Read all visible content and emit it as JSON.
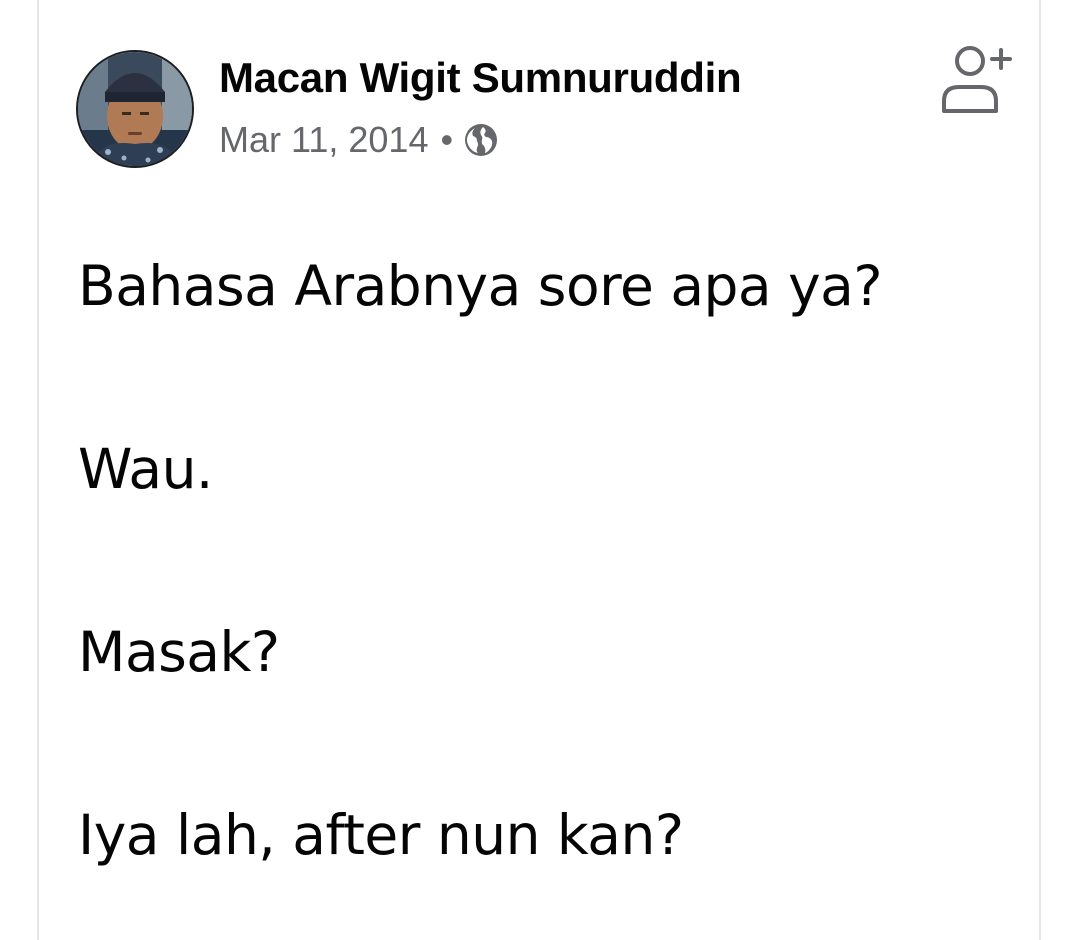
{
  "post": {
    "author": "Macan Wigit Sumnuruddin",
    "date": "Mar 11, 2014",
    "separator": "•",
    "privacy_icon": "globe-icon",
    "action_icon": "add-friend-icon",
    "lines": [
      "Bahasa Arabnya sore apa ya?",
      "Wau.",
      "Masak?",
      "Iya lah, after nun kan?"
    ]
  },
  "colors": {
    "text": "#050505",
    "secondary_text": "#65676b",
    "border": "#e4e6eb"
  }
}
